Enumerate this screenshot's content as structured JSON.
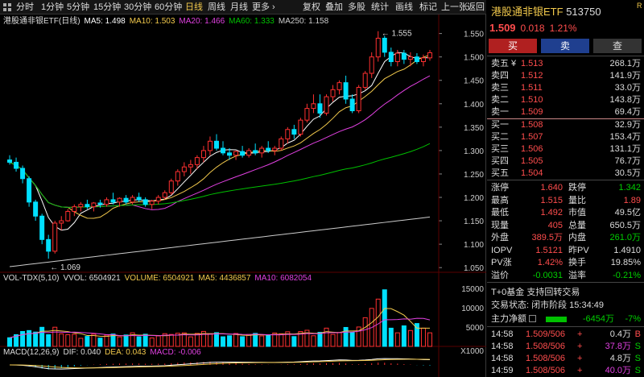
{
  "toolbar": {
    "items": [
      "分时",
      "1分钟",
      "5分钟",
      "15分钟",
      "30分钟",
      "60分钟",
      "日线",
      "周线",
      "月线",
      "更多 ›",
      "复权",
      "叠加",
      "多股",
      "统计",
      "画线",
      "标记",
      "上一张",
      "返回"
    ],
    "active": "日线"
  },
  "chart": {
    "name": "港股通非银ETF(日线)",
    "ma": [
      {
        "label": "MA5: 1.498",
        "color": "#ffffff"
      },
      {
        "label": "MA10: 1.503",
        "color": "#f2c94c"
      },
      {
        "label": "MA20: 1.466",
        "color": "#e040e0"
      },
      {
        "label": "MA60: 1.333",
        "color": "#00c000"
      },
      {
        "label": "MA250: 1.158",
        "color": "#cccccc"
      }
    ],
    "price_ticks": [
      "1.550",
      "1.500",
      "1.450",
      "1.400",
      "1.350",
      "1.300",
      "1.250",
      "1.200",
      "1.150",
      "1.100",
      "1.050"
    ],
    "high_marker": "1.555",
    "low_marker": "1.069",
    "vol_legend": [
      {
        "label": "VOL-TDX(5,10)",
        "color": "#dddddd"
      },
      {
        "label": "VVOL: 6504921",
        "color": "#dddddd"
      },
      {
        "label": "VOLUME: 6504921",
        "color": "#f2c94c"
      },
      {
        "label": "MA5: 4436857",
        "color": "#f2c94c"
      },
      {
        "label": "MA10: 6082054",
        "color": "#e040e0"
      }
    ],
    "vol_ticks": [
      "15000",
      "10000",
      "5000"
    ],
    "vol_unit": "X1000",
    "macd_legend": [
      {
        "label": "MACD(12,26,9)",
        "color": "#dddddd"
      },
      {
        "label": "DIF: 0.040",
        "color": "#dddddd"
      },
      {
        "label": "DEA: 0.043",
        "color": "#f2c94c"
      },
      {
        "label": "MACD: -0.006",
        "color": "#e040e0"
      }
    ]
  },
  "chart_data": {
    "type": "candlestick",
    "title": "港股通非银ETF(日线)",
    "ylim": [
      1.04,
      1.57
    ],
    "ohlc": [
      [
        1.28,
        1.29,
        1.27,
        1.275
      ],
      [
        1.275,
        1.285,
        1.255,
        1.262
      ],
      [
        1.262,
        1.268,
        1.23,
        1.24
      ],
      [
        1.24,
        1.245,
        1.18,
        1.19
      ],
      [
        1.19,
        1.195,
        1.15,
        1.16
      ],
      [
        1.16,
        1.165,
        1.1,
        1.11
      ],
      [
        1.11,
        1.12,
        1.069,
        1.085
      ],
      [
        1.085,
        1.15,
        1.08,
        1.145
      ],
      [
        1.145,
        1.16,
        1.13,
        1.15
      ],
      [
        1.15,
        1.175,
        1.148,
        1.17
      ],
      [
        1.17,
        1.185,
        1.16,
        1.18
      ],
      [
        1.18,
        1.19,
        1.17,
        1.185
      ],
      [
        1.185,
        1.195,
        1.175,
        1.18
      ],
      [
        1.18,
        1.19,
        1.17,
        1.188
      ],
      [
        1.188,
        1.195,
        1.178,
        1.185
      ],
      [
        1.185,
        1.2,
        1.18,
        1.195
      ],
      [
        1.195,
        1.21,
        1.185,
        1.19
      ],
      [
        1.19,
        1.2,
        1.18,
        1.198
      ],
      [
        1.198,
        1.205,
        1.185,
        1.19
      ],
      [
        1.19,
        1.205,
        1.185,
        1.2
      ],
      [
        1.2,
        1.21,
        1.19,
        1.195
      ],
      [
        1.195,
        1.2,
        1.18,
        1.185
      ],
      [
        1.185,
        1.195,
        1.175,
        1.192
      ],
      [
        1.192,
        1.205,
        1.185,
        1.2
      ],
      [
        1.2,
        1.215,
        1.195,
        1.21
      ],
      [
        1.21,
        1.24,
        1.205,
        1.235
      ],
      [
        1.235,
        1.26,
        1.225,
        1.255
      ],
      [
        1.255,
        1.275,
        1.245,
        1.265
      ],
      [
        1.265,
        1.28,
        1.25,
        1.27
      ],
      [
        1.27,
        1.29,
        1.26,
        1.285
      ],
      [
        1.285,
        1.31,
        1.275,
        1.3
      ],
      [
        1.3,
        1.33,
        1.29,
        1.32
      ],
      [
        1.32,
        1.335,
        1.3,
        1.305
      ],
      [
        1.305,
        1.32,
        1.29,
        1.295
      ],
      [
        1.295,
        1.305,
        1.28,
        1.29
      ],
      [
        1.29,
        1.3,
        1.28,
        1.298
      ],
      [
        1.298,
        1.31,
        1.285,
        1.29
      ],
      [
        1.29,
        1.305,
        1.285,
        1.3
      ],
      [
        1.3,
        1.315,
        1.29,
        1.295
      ],
      [
        1.295,
        1.31,
        1.285,
        1.305
      ],
      [
        1.305,
        1.32,
        1.295,
        1.3
      ],
      [
        1.3,
        1.31,
        1.29,
        1.305
      ],
      [
        1.305,
        1.33,
        1.3,
        1.325
      ],
      [
        1.325,
        1.35,
        1.315,
        1.345
      ],
      [
        1.345,
        1.355,
        1.325,
        1.335
      ],
      [
        1.335,
        1.37,
        1.33,
        1.365
      ],
      [
        1.365,
        1.4,
        1.36,
        1.39
      ],
      [
        1.39,
        1.42,
        1.38,
        1.4
      ],
      [
        1.4,
        1.42,
        1.37,
        1.38
      ],
      [
        1.38,
        1.42,
        1.375,
        1.415
      ],
      [
        1.415,
        1.44,
        1.405,
        1.43
      ],
      [
        1.43,
        1.45,
        1.42,
        1.445
      ],
      [
        1.445,
        1.46,
        1.4,
        1.41
      ],
      [
        1.41,
        1.42,
        1.38,
        1.385
      ],
      [
        1.385,
        1.44,
        1.38,
        1.435
      ],
      [
        1.435,
        1.47,
        1.43,
        1.465
      ],
      [
        1.465,
        1.51,
        1.455,
        1.5
      ],
      [
        1.5,
        1.555,
        1.49,
        1.54
      ],
      [
        1.54,
        1.545,
        1.5,
        1.51
      ],
      [
        1.51,
        1.52,
        1.48,
        1.49
      ],
      [
        1.49,
        1.515,
        1.48,
        1.508
      ],
      [
        1.508,
        1.515,
        1.485,
        1.495
      ],
      [
        1.495,
        1.51,
        1.48,
        1.5
      ],
      [
        1.5,
        1.508,
        1.485,
        1.49
      ],
      [
        1.49,
        1.505,
        1.48,
        1.498
      ],
      [
        1.498,
        1.515,
        1.492,
        1.509
      ]
    ]
  },
  "panel": {
    "title": "港股通非银ETF",
    "code": "513750",
    "badge": "R",
    "price": "1.509",
    "change": "0.018",
    "pct": "1.21%",
    "buttons": [
      {
        "label": "买",
        "bg": "#b02020",
        "fg": "#ffffff"
      },
      {
        "label": "卖",
        "bg": "#1f3f8f",
        "fg": "#ffffff"
      },
      {
        "label": "查",
        "bg": "#333333",
        "fg": "#dddddd"
      }
    ],
    "sells": [
      {
        "label": "卖五 ¥",
        "price": "1.513",
        "vol": "268.1万"
      },
      {
        "label": "卖四",
        "price": "1.512",
        "vol": "141.9万"
      },
      {
        "label": "卖三",
        "price": "1.511",
        "vol": "33.0万"
      },
      {
        "label": "卖二",
        "price": "1.510",
        "vol": "143.8万"
      },
      {
        "label": "卖一",
        "price": "1.509",
        "vol": "69.4万"
      }
    ],
    "buys": [
      {
        "label": "买一",
        "price": "1.508",
        "vol": "32.9万"
      },
      {
        "label": "买二",
        "price": "1.507",
        "vol": "153.4万"
      },
      {
        "label": "买三",
        "price": "1.506",
        "vol": "131.1万"
      },
      {
        "label": "买四",
        "price": "1.505",
        "vol": "76.7万"
      },
      {
        "label": "买五",
        "price": "1.504",
        "vol": "30.5万"
      }
    ],
    "stats": [
      [
        "涨停",
        "1.640",
        "red",
        "跌停",
        "1.342",
        "green"
      ],
      [
        "最高",
        "1.515",
        "red",
        "量比",
        "1.89",
        "red"
      ],
      [
        "最低",
        "1.492",
        "red",
        "市值",
        "49.5亿",
        "white"
      ],
      [
        "现量",
        "405",
        "red",
        "总量",
        "650.5万",
        "white"
      ],
      [
        "外盘",
        "389.5万",
        "red",
        "内盘",
        "261.0万",
        "green"
      ],
      [
        "IOPV",
        "1.5121",
        "red",
        "昨PV",
        "1.4910",
        "white"
      ],
      [
        "PV涨",
        "1.42%",
        "red",
        "换手",
        "19.85%",
        "white"
      ],
      [
        "溢价",
        "-0.0031",
        "green",
        "溢率",
        "-0.21%",
        "green"
      ]
    ],
    "info1": "T+0基金 支持回转交易",
    "info2": "交易状态: 闭市阶段 15:34:49",
    "flow_label": "主力净额",
    "flow_value": "-6454万",
    "flow_pct": "-7%",
    "trades": [
      {
        "time": "14:58",
        "price": "1.509/506",
        "sign": "+",
        "vol": "0.4万",
        "side": "B",
        "vcol": "white",
        "scol": "red"
      },
      {
        "time": "14:58",
        "price": "1.508/506",
        "sign": "+",
        "vol": "37.8万",
        "side": "S",
        "vcol": "magenta",
        "scol": "green"
      },
      {
        "time": "14:58",
        "price": "1.508/506",
        "sign": "+",
        "vol": "4.8万",
        "side": "S",
        "vcol": "white",
        "scol": "green"
      },
      {
        "time": "14:59",
        "price": "1.508/506",
        "sign": "+",
        "vol": "40.0万",
        "side": "S",
        "vcol": "magenta",
        "scol": "green"
      }
    ]
  }
}
